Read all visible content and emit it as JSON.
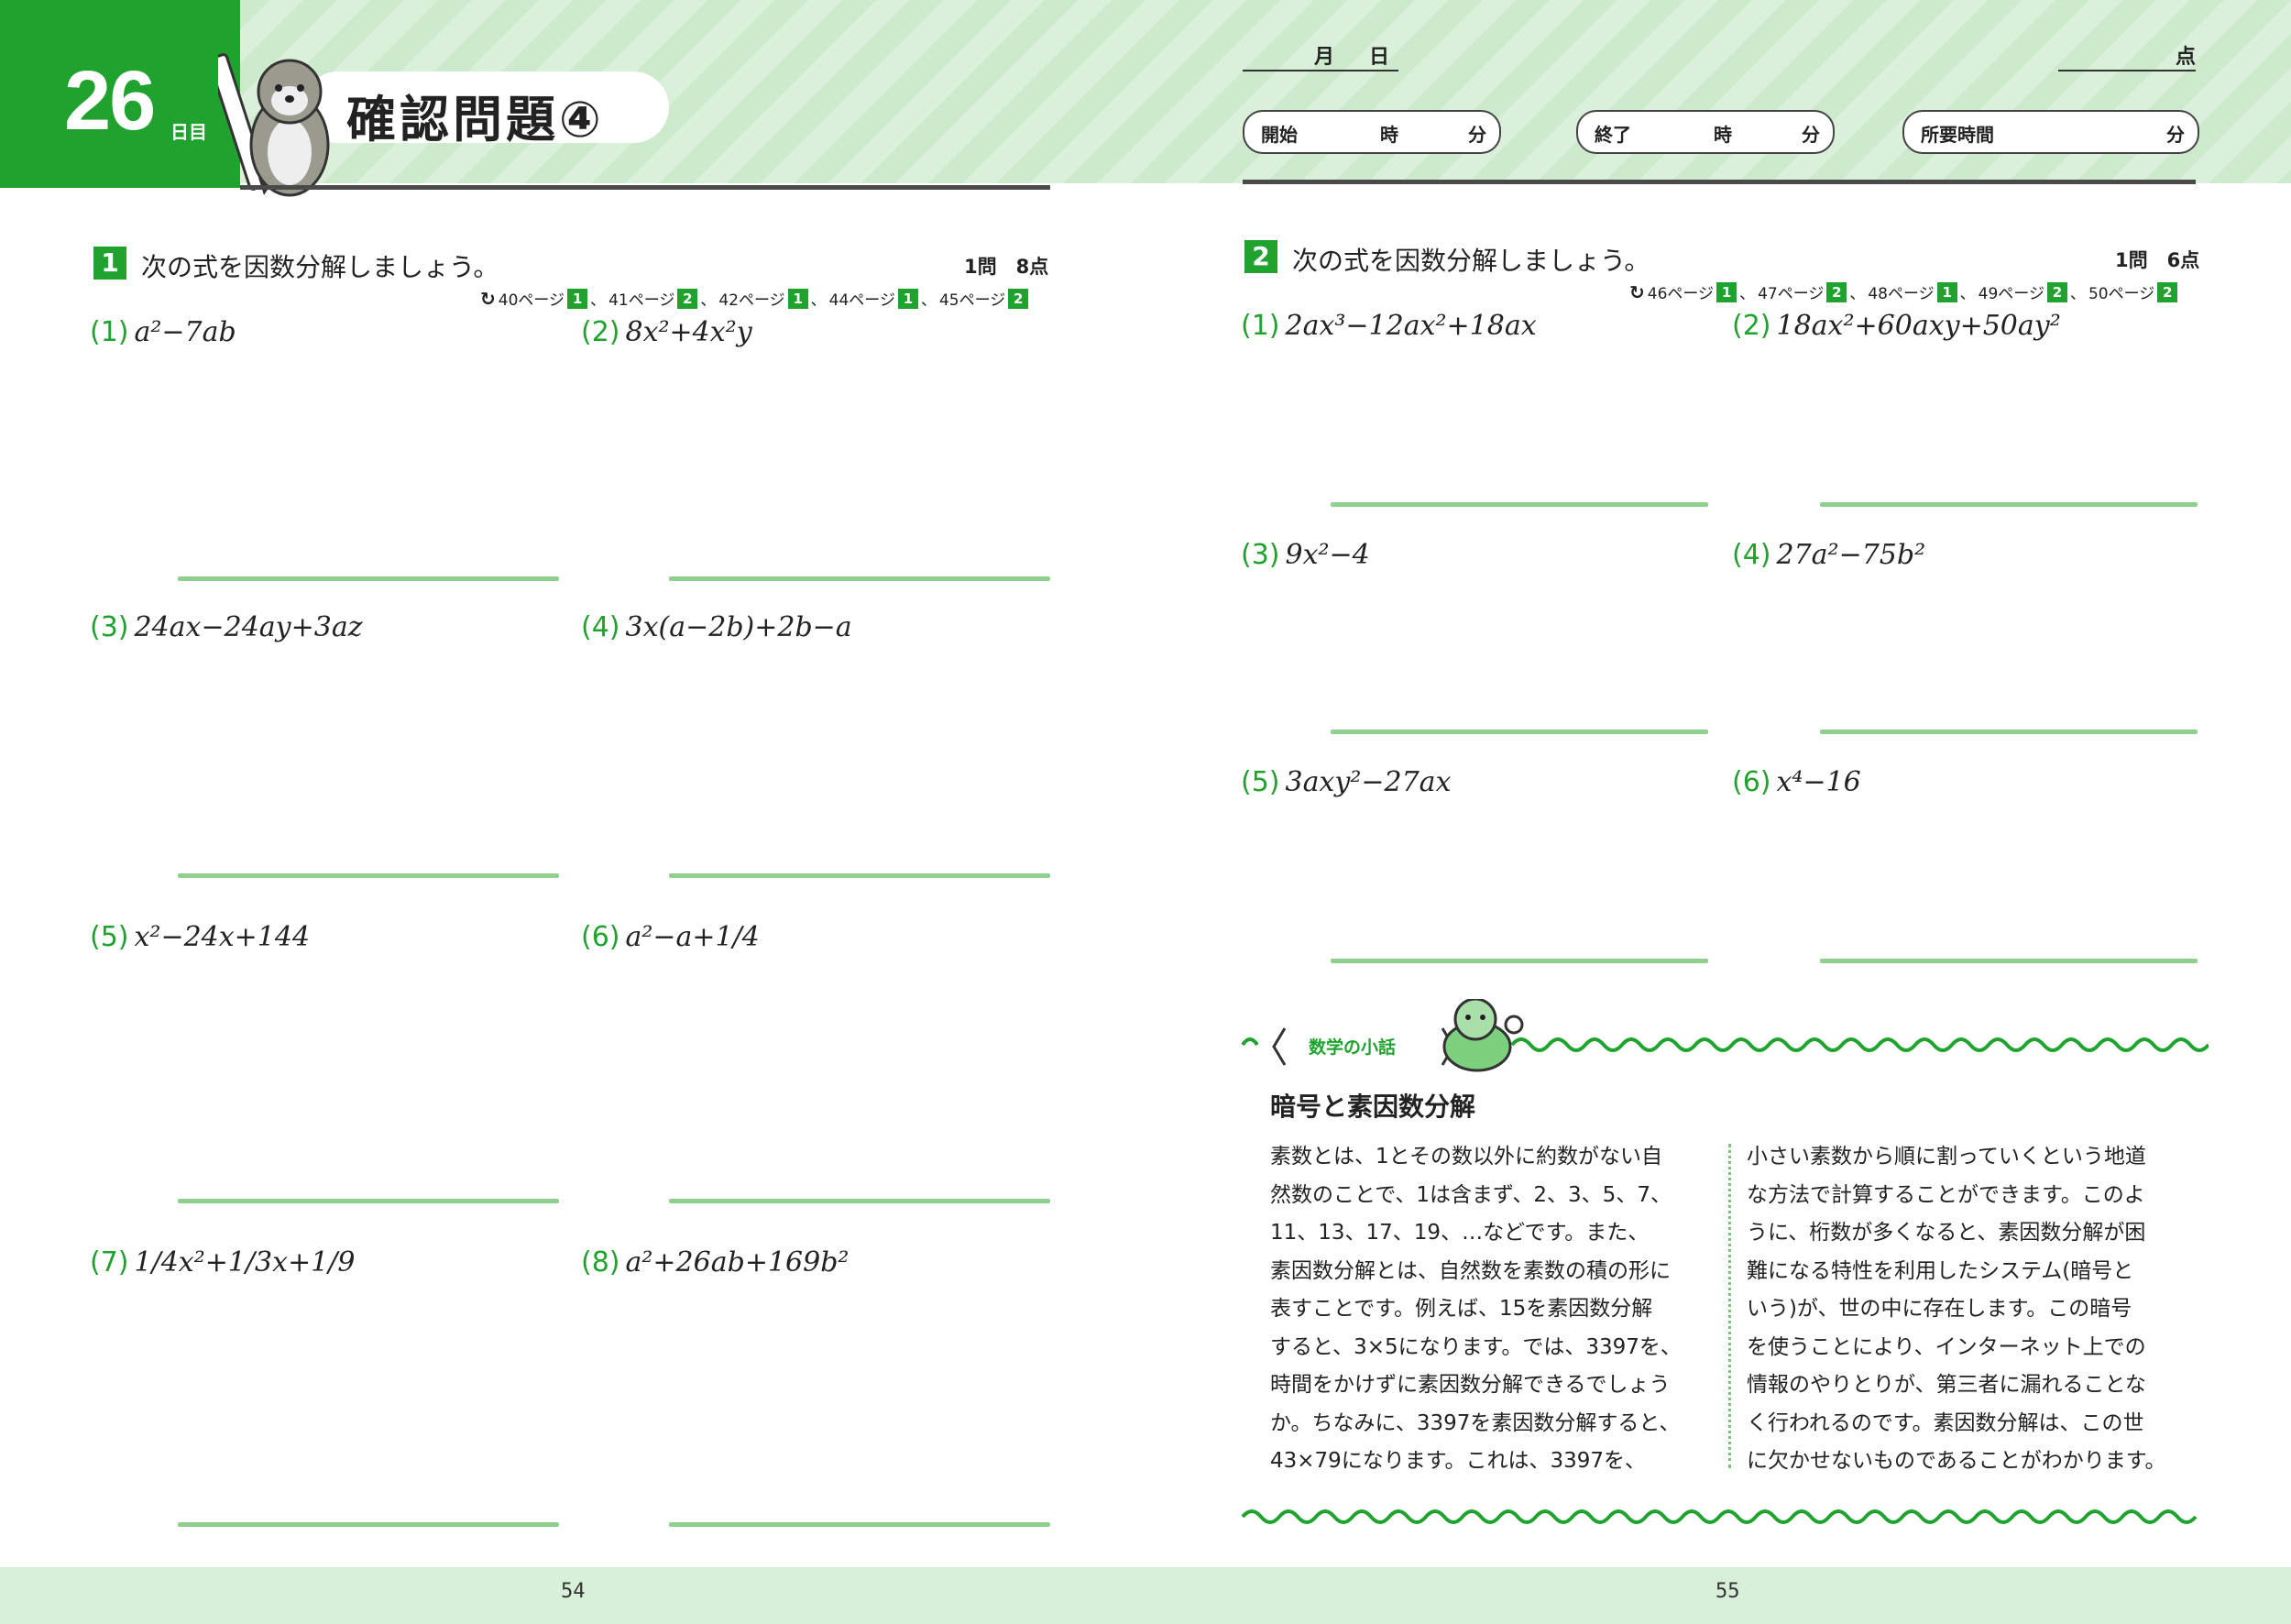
{
  "left_page": {
    "day_number": "26",
    "day_unit": "日目",
    "title": "確認問題④",
    "question": {
      "number": "1",
      "text": "次の式を因数分解しましょう。",
      "points": "1問　8点",
      "refs": [
        {
          "page": "40ページ",
          "badge": "1"
        },
        {
          "page": "41ページ",
          "badge": "2"
        },
        {
          "page": "42ページ",
          "badge": "1"
        },
        {
          "page": "44ページ",
          "badge": "1"
        },
        {
          "page": "45ページ",
          "badge": "2"
        }
      ]
    },
    "problems": [
      {
        "label": "(1)",
        "expr": "a²−7ab"
      },
      {
        "label": "(2)",
        "expr": "8x²+4x²y"
      },
      {
        "label": "(3)",
        "expr": "24ax−24ay+3az"
      },
      {
        "label": "(4)",
        "expr": "3x(a−2b)+2b−a"
      },
      {
        "label": "(5)",
        "expr": "x²−24x+144"
      },
      {
        "label": "(6)",
        "expr": "a²−a+1/4"
      },
      {
        "label": "(7)",
        "expr": "1/4x²+1/3x+1/9"
      },
      {
        "label": "(8)",
        "expr": "a²+26ab+169b²"
      }
    ],
    "page_number": "54"
  },
  "right_page": {
    "date_month": "月",
    "date_day": "日",
    "score_unit": "点",
    "start_label": "開始",
    "end_label": "終了",
    "elapsed_label": "所要時間",
    "hour_unit": "時",
    "minute_unit": "分",
    "question": {
      "number": "2",
      "text": "次の式を因数分解しましょう。",
      "points": "1問　6点",
      "refs": [
        {
          "page": "46ページ",
          "badge": "1"
        },
        {
          "page": "47ページ",
          "badge": "2"
        },
        {
          "page": "48ページ",
          "badge": "1"
        },
        {
          "page": "49ページ",
          "badge": "2"
        },
        {
          "page": "50ページ",
          "badge": "2"
        }
      ]
    },
    "problems": [
      {
        "label": "(1)",
        "expr": "2ax³−12ax²+18ax"
      },
      {
        "label": "(2)",
        "expr": "18ax²+60axy+50ay²"
      },
      {
        "label": "(3)",
        "expr": "9x²−4"
      },
      {
        "label": "(4)",
        "expr": "27a²−75b²"
      },
      {
        "label": "(5)",
        "expr": "3axy²−27ax"
      },
      {
        "label": "(6)",
        "expr": "x⁴−16"
      }
    ],
    "column": {
      "tag": "数学の小話",
      "title": "暗号と素因数分解",
      "left_lines": [
        "素数とは、1とその数以外に約数がない自",
        "然数のことで、1は含まず、2、3、5、7、",
        "11、13、17、19、…などです。また、",
        "素因数分解とは、自然数を素数の積の形に",
        "表すことです。例えば、15を素因数分解",
        "すると、3×5になります。では、3397を、",
        "時間をかけずに素因数分解できるでしょう",
        "か。ちなみに、3397を素因数分解すると、",
        "43×79になります。これは、3397を、"
      ],
      "right_lines": [
        "小さい素数から順に割っていくという地道",
        "な方法で計算することができます。このよ",
        "うに、桁数が多くなると、素因数分解が困",
        "難になる特性を利用したシステム(暗号と",
        "いう)が、世の中に存在します。この暗号",
        "を使うことにより、インターネット上での",
        "情報のやりとりが、第三者に漏れることな",
        "く行われるのです。素因数分解は、この世",
        "に欠かせないものであることがわかります。"
      ]
    },
    "page_number": "55"
  },
  "colors": {
    "accent": "#1fa22e",
    "line": "#8fd08f",
    "band": "#d8efd8"
  }
}
